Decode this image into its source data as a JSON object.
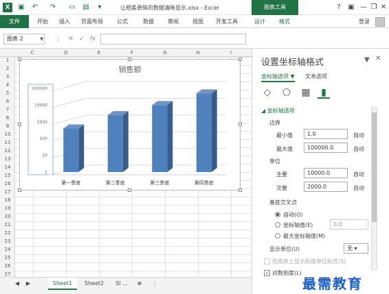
{
  "window": {
    "title": "让相差悬殊的数据清晰显示.xlsx - Excel",
    "context_tab": "图表工具",
    "help": "?",
    "min": "—",
    "restore": "❐",
    "close": "✕"
  },
  "quick_access": {
    "save_icon": "save-icon",
    "undo_icon": "undo-icon",
    "redo_icon": "redo-icon"
  },
  "ribbon": {
    "file": "文件",
    "tabs": [
      "开始",
      "插入",
      "页面布局",
      "公式",
      "数据",
      "审阅",
      "视图",
      "开发工具",
      "设计",
      "格式"
    ],
    "user": "登录"
  },
  "formula_bar": {
    "name_box": "图表 2",
    "cancel": "✕",
    "enter": "✓",
    "fx": "fx",
    "value": ""
  },
  "sheet": {
    "columns": [
      "C",
      "D",
      "E",
      "F",
      "G",
      "H",
      "I"
    ],
    "rows": [
      "1",
      "2",
      "3",
      "4",
      "5",
      "6",
      "7",
      "8",
      "9",
      "10",
      "11",
      "12",
      "13",
      "14",
      "15",
      "16",
      "17",
      "18",
      "19",
      "20",
      "21",
      "22",
      "23",
      "24",
      "25",
      "26",
      "27"
    ]
  },
  "chart_data": {
    "type": "bar",
    "title": "销售额",
    "categories": [
      "第一季度",
      "第二季度",
      "第三季度",
      "第四季度"
    ],
    "series": [
      {
        "values": [
          400,
          2500,
          10000,
          50000
        ]
      }
    ],
    "scale": "log",
    "yticks": [
      "100000",
      "10000",
      "1000",
      "100",
      "10",
      "1"
    ],
    "ylim": [
      1,
      100000
    ],
    "three_d": true,
    "bar_color": "#4f81bd",
    "grid": true
  },
  "sheet_tabs": [
    "Sheet1",
    "Sheet2",
    "Sl ..."
  ],
  "pane": {
    "title": "设置坐标轴格式",
    "tab_axis": "坐标轴选项",
    "tab_text": "文本选项",
    "section": "坐标轴选项",
    "bounds_label": "边界",
    "min_label": "最小值",
    "min_value": "1.0",
    "max_label": "最大值",
    "max_value": "100000.0",
    "units_label": "单位",
    "major_label": "主要",
    "major_value": "10000.0",
    "minor_label": "次要",
    "minor_value": "2000.0",
    "auto": "自动",
    "cross_label": "基底交叉点",
    "cross_auto": "自动(O)",
    "cross_value_label": "坐标轴值(E)",
    "cross_value": "0.0",
    "cross_max": "最大坐标轴值(M)",
    "display_units_label": "显示单位(U)",
    "display_units_value": "无",
    "show_units_label": "在图表上显示刻度单位标签(S)",
    "log_label": "对数刻度(L)",
    "log_checked": true,
    "icons": [
      "fill-icon",
      "shape-effects-icon",
      "size-properties-icon",
      "axis-options-bar-icon"
    ]
  },
  "watermark": "最需教育",
  "colors": {
    "excel_green": "#217346",
    "bar": "#4f81bd"
  }
}
